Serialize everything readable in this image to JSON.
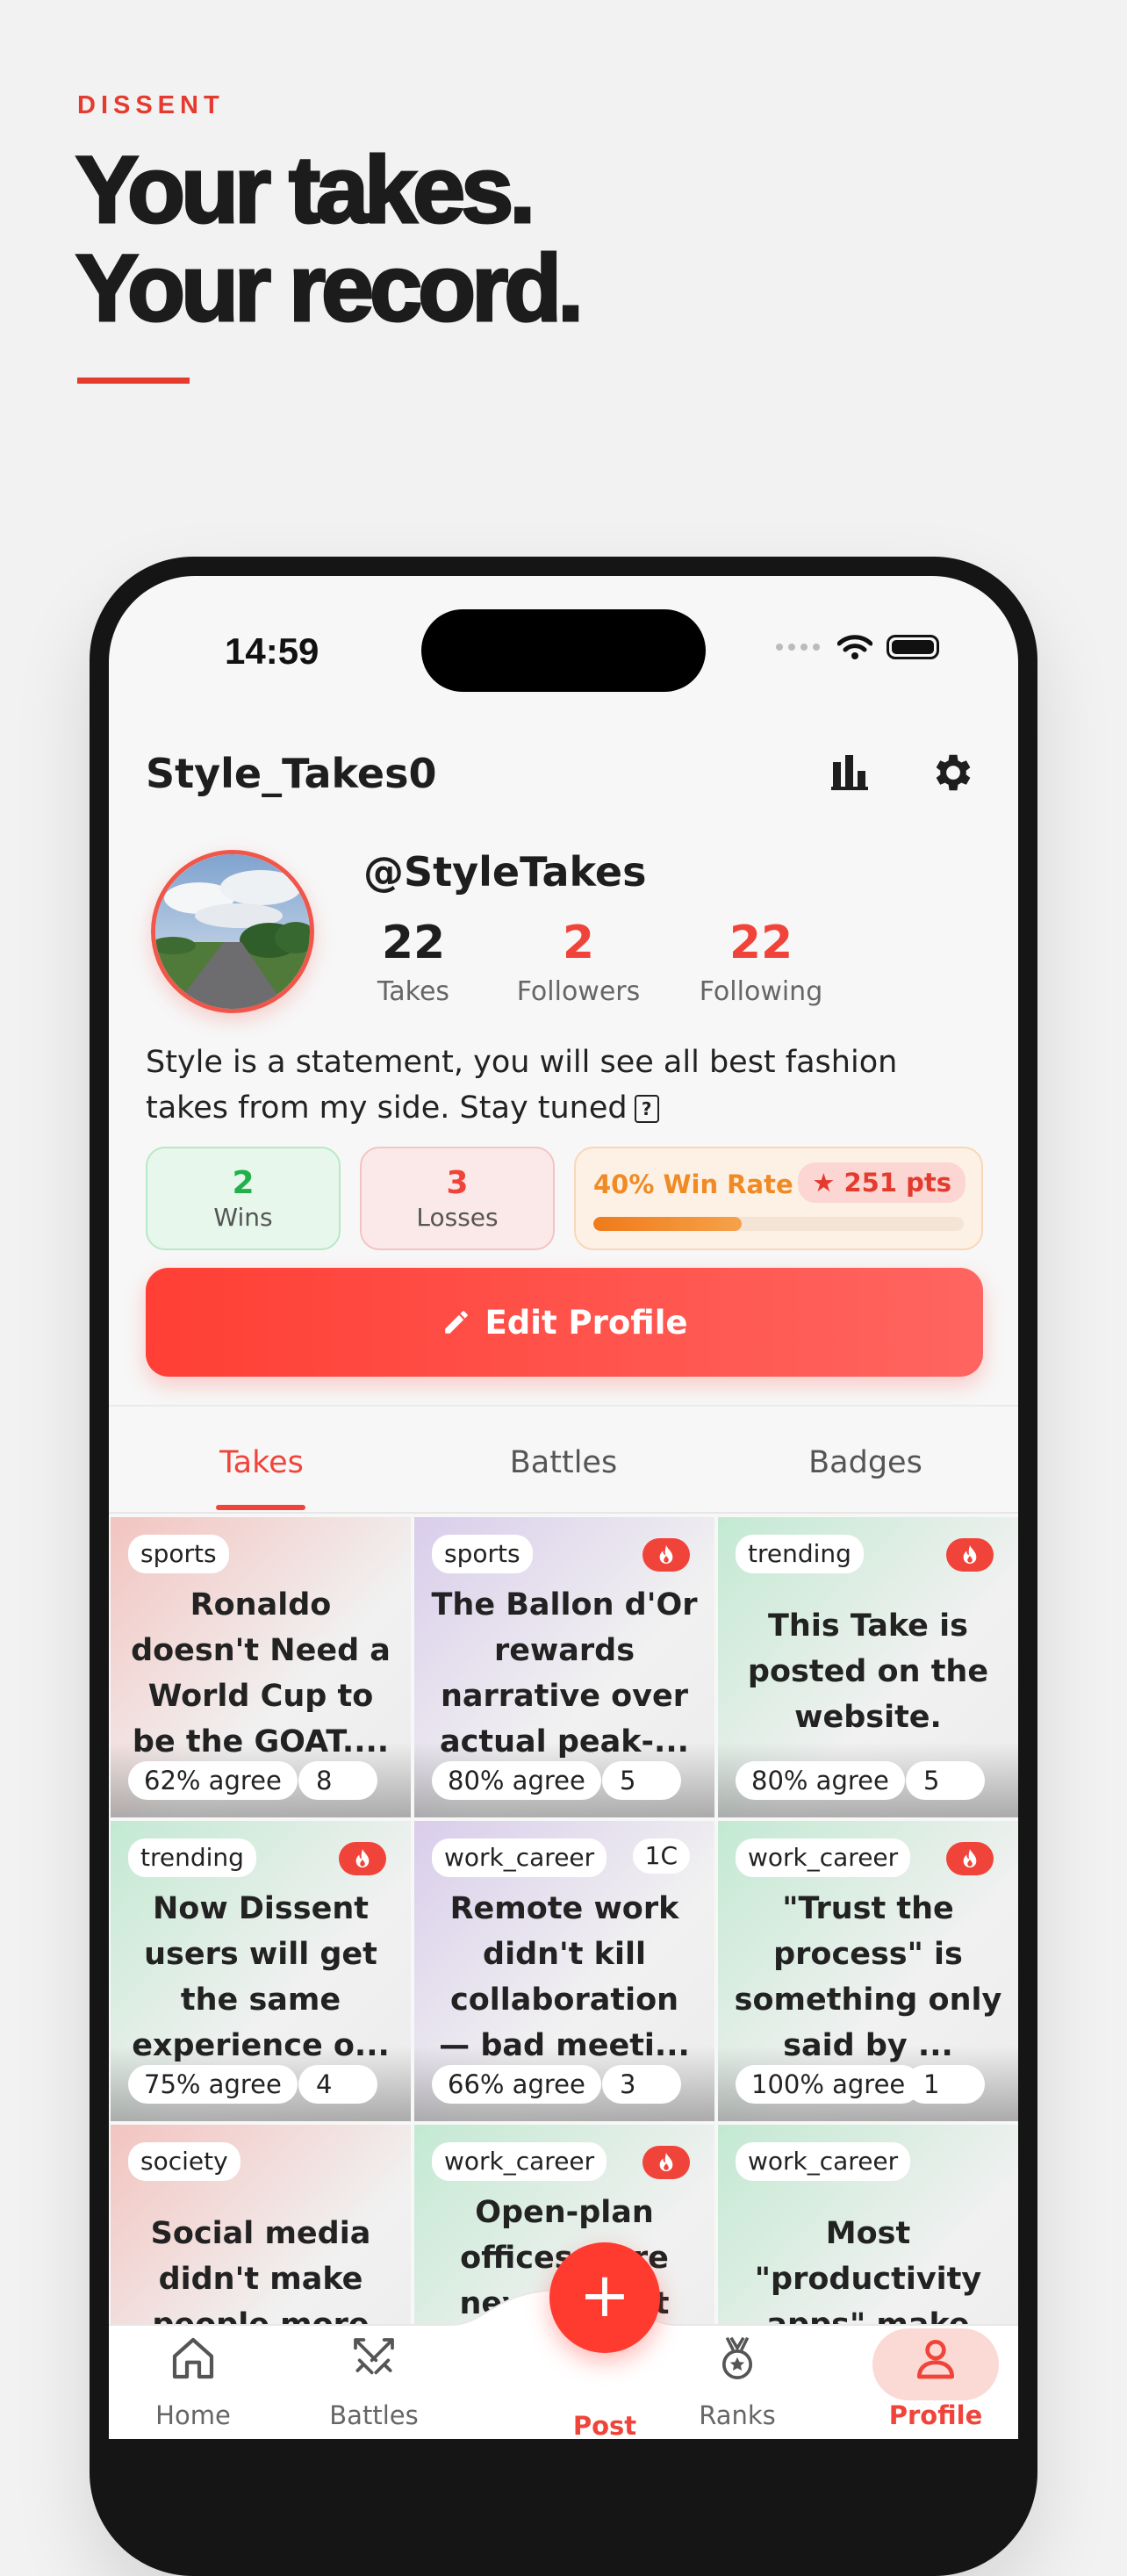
{
  "brand": "DISSENT",
  "headline": [
    "Your takes.",
    "Your record."
  ],
  "status": {
    "time": "14:59"
  },
  "nav": {
    "title": "Style_Takes0",
    "stats_icon": "bar-chart-icon",
    "settings_icon": "gear-icon"
  },
  "profile": {
    "handle": "@StyleTakes",
    "stats": [
      {
        "value": "22",
        "label": "Takes",
        "color": "#1e1e1e"
      },
      {
        "value": "2",
        "label": "Followers",
        "color": "#f0443a"
      },
      {
        "value": "22",
        "label": "Following",
        "color": "#f0443a"
      }
    ],
    "bio": "Style is a statement, you will see all best fashion takes from my side. Stay tuned",
    "bio_symbol": "?"
  },
  "record": {
    "wins": {
      "value": "2",
      "label": "Wins",
      "color": "#22b04b"
    },
    "losses": {
      "value": "3",
      "label": "Losses",
      "color": "#f0443a"
    },
    "win_rate_text": "40% Win Rate",
    "win_rate": 0.4,
    "points": "★ 251 pts"
  },
  "edit_button": "Edit Profile",
  "tabs": [
    "Takes",
    "Battles",
    "Badges"
  ],
  "active_tab": "Takes",
  "takes": [
    {
      "category": "sports",
      "title": "Ronaldo doesn't Need a World Cup to be the GOAT....",
      "agree": "62% agree",
      "count": "8",
      "hot": false,
      "tint": "#f2c4c0"
    },
    {
      "category": "sports",
      "title": "The Ballon d'Or rewards narrative over actual peak-...",
      "agree": "80% agree",
      "count": "5",
      "hot": true,
      "tint": "#d9cdeb"
    },
    {
      "category": "trending",
      "title": "This Take is posted on the website.",
      "agree": "80% agree",
      "count": "5",
      "hot": true,
      "tint": "#c3e9d2"
    },
    {
      "category": "trending",
      "title": "Now Dissent users will get the same experience o...",
      "agree": "75% agree",
      "count": "4",
      "hot": true,
      "tint": "#c3e9d2"
    },
    {
      "category": "work_career",
      "title": "Remote work didn't kill collaboration — bad meeti...",
      "agree": "66% agree",
      "count": "3",
      "hot": false,
      "extra": "1C",
      "tint": "#d9cdeb"
    },
    {
      "category": "work_career",
      "title": "\"Trust the process\" is something only said by ...",
      "agree": "100% agree",
      "count": "1",
      "hot": true,
      "tint": "#c3e9d2"
    },
    {
      "category": "society",
      "title": "Social media didn't make people more",
      "agree": "",
      "count": "",
      "hot": false,
      "tint": "#f2c4c0"
    },
    {
      "category": "work_career",
      "title": "Open-plan offices were never about collaboration",
      "agree": "",
      "count": "",
      "hot": true,
      "tint": "#c3e9d2"
    },
    {
      "category": "work_career",
      "title": "Most \"productivity apps\" make",
      "agree": "",
      "count": "",
      "hot": false,
      "tint": "#c3e9d2"
    }
  ],
  "tabbar": [
    {
      "label": "Home",
      "icon": "home-icon"
    },
    {
      "label": "Battles",
      "icon": "swords-icon"
    },
    {
      "label": "Post",
      "icon": "plus-icon"
    },
    {
      "label": "Ranks",
      "icon": "medal-icon"
    },
    {
      "label": "Profile",
      "icon": "person-icon"
    }
  ]
}
